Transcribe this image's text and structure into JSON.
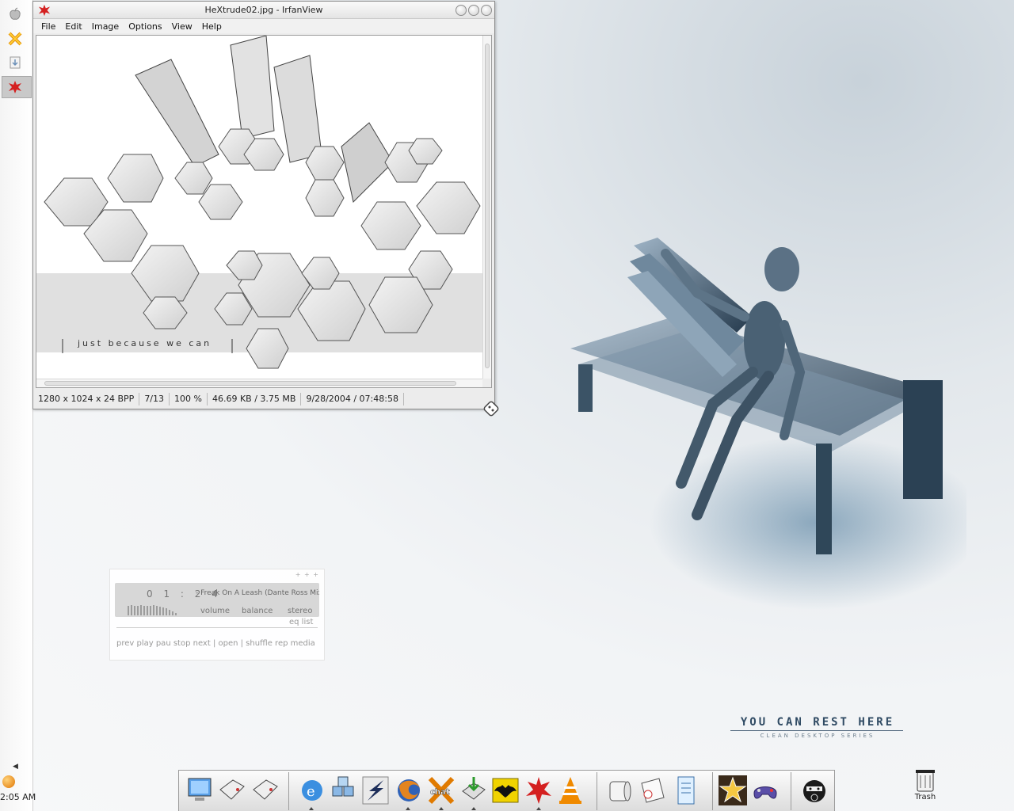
{
  "window": {
    "title": "HeXtrude02.jpg - IrfanView",
    "menu": [
      "File",
      "Edit",
      "Image",
      "Options",
      "View",
      "Help"
    ],
    "image_caption": "just because we can",
    "status": [
      "1280 x 1024 x 24 BPP",
      "7/13",
      "100 %",
      "46.69 KB / 3.75 MB",
      "9/28/2004 / 07:48:58"
    ]
  },
  "player": {
    "time": "0 1 : 2 4",
    "track": "- Freak On A Leash (Dante Ross Mix)",
    "volume_label": "volume",
    "balance_label": "balance",
    "stereo_label": "stereo",
    "eq_label": "eq  list",
    "controls": "prev play pau stop next | open | shuffle rep media"
  },
  "wallpaper": {
    "tagline": "YOU CAN REST HERE",
    "subtitle": "CLEAN DESKTOP SERIES"
  },
  "clock": "2:05 AM",
  "trash_label": "Trash",
  "leftbar_icons": [
    "apple-icon",
    "crossed-tools-icon",
    "download-icon",
    "irfanview-icon"
  ],
  "dock_icons": [
    "my-computer-icon",
    "drive-icon",
    "drive-icon-2",
    "internet-explorer-icon",
    "network-cubes-icon",
    "winamp-bolt-icon",
    "firefox-icon",
    "chat-icon",
    "download-manager-icon",
    "bat-mail-icon",
    "irfanview-splat-icon",
    "vlc-cone-icon",
    "toilet-paper-icon",
    "notes-icon",
    "text-document-icon",
    "star-game-icon",
    "gamepad-icon",
    "ninja-icon"
  ],
  "colors": {
    "tagline": "#2f4a63",
    "irfan_red": "#d42020",
    "dock_bg": "#e6e6e6"
  }
}
